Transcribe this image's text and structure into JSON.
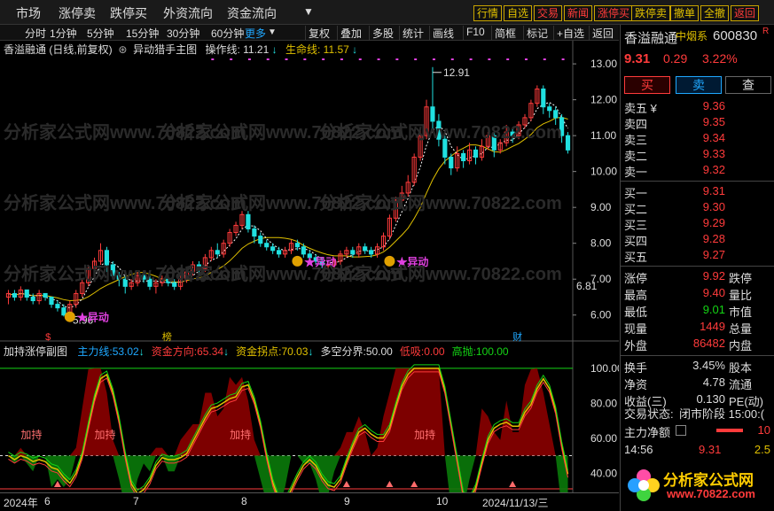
{
  "nav": {
    "items": [
      "市场",
      "涨停卖",
      "跌停买",
      "外资流向",
      "资金流向"
    ],
    "buttons": [
      {
        "label": "行情",
        "red": false
      },
      {
        "label": "自选",
        "red": false
      },
      {
        "label": "交易",
        "red": true
      },
      {
        "label": "新闻",
        "red": true
      },
      {
        "label": "涨停买",
        "red": true
      },
      {
        "label": "跌停卖",
        "red": false
      },
      {
        "label": "撤单",
        "red": false
      },
      {
        "label": "全撤",
        "red": false
      },
      {
        "label": "返回",
        "red": true
      }
    ]
  },
  "toolbar": {
    "periods": [
      "分时",
      "1分钟",
      "5分钟",
      "15分钟",
      "30分钟",
      "60分钟"
    ],
    "more": "更多",
    "tools": [
      "复权",
      "叠加",
      "多股",
      "统计",
      "画线",
      "F10",
      "简框",
      "标记",
      "+自选",
      "返回"
    ]
  },
  "main_chart": {
    "title": "香溢融通 (日线,前复权)",
    "indicator_name": "异动猎手主图",
    "op_line_label": "操作线:",
    "op_line_value": "11.21",
    "life_line_label": "生命线:",
    "life_line_value": "11.57",
    "max_label": "12.91",
    "min_label": "5.96",
    "signal_label": "★异动",
    "y_ticks": [
      "13.00",
      "12.00",
      "11.00",
      "10.00",
      "9.00",
      "8.00",
      "7.00",
      "6.00"
    ],
    "current_price_tag": "6.81",
    "markers": [
      "$",
      "榜",
      "财"
    ]
  },
  "sub_chart": {
    "title": "加持涨停副图",
    "fields": [
      {
        "label": "主力线:",
        "value": "53.02",
        "color": "#1fa8ff"
      },
      {
        "label": "资金方向:",
        "value": "65.34",
        "color": "#ff3b3b"
      },
      {
        "label": "资金拐点:",
        "value": "70.03",
        "color": "#e0c000"
      },
      {
        "label": "多空分界:",
        "value": "50.00",
        "color": "#dddddd"
      },
      {
        "label": "低吸:",
        "value": "0.00",
        "color": "#ff3b3b"
      },
      {
        "label": "高抛:",
        "value": "100.00",
        "color": "#14d414"
      }
    ],
    "y_ticks": [
      "100.00",
      "80.00",
      "60.00",
      "40.00"
    ],
    "hold_label": "加持"
  },
  "x_axis": {
    "labels": [
      "2024年",
      "6",
      "7",
      "8",
      "9",
      "10",
      "2024/11/13/三"
    ]
  },
  "quote": {
    "name": "香溢融通",
    "sector": "中烟系",
    "code": "600830",
    "price": "9.31",
    "change": "0.29",
    "change_pct": "3.22%",
    "buttons": [
      "买",
      "卖",
      "查"
    ],
    "asks": [
      {
        "label": "卖五 ¥",
        "price": "9.36"
      },
      {
        "label": "卖四",
        "price": "9.35"
      },
      {
        "label": "卖三",
        "price": "9.34"
      },
      {
        "label": "卖二",
        "price": "9.33"
      },
      {
        "label": "卖一",
        "price": "9.32"
      }
    ],
    "bids": [
      {
        "label": "买一",
        "price": "9.31"
      },
      {
        "label": "买二",
        "price": "9.30"
      },
      {
        "label": "买三",
        "price": "9.29"
      },
      {
        "label": "买四",
        "price": "9.28"
      },
      {
        "label": "买五",
        "price": "9.27"
      }
    ],
    "stats": [
      {
        "label": "涨停",
        "value": "9.92",
        "color": "up",
        "right": "跌停"
      },
      {
        "label": "最高",
        "value": "9.40",
        "color": "up",
        "right": "量比"
      },
      {
        "label": "最低",
        "value": "9.01",
        "color": "dn",
        "right": "市值"
      },
      {
        "label": "现量",
        "value": "1449",
        "color": "up",
        "right": "总量"
      },
      {
        "label": "外盘",
        "value": "86482",
        "color": "up",
        "right": "内盘"
      }
    ],
    "stats2": [
      {
        "label": "换手",
        "value": "3.45%",
        "right": "股本"
      },
      {
        "label": "净资",
        "value": "4.78",
        "right": "流通"
      },
      {
        "label": "收益(三)",
        "value": "0.130",
        "right": "PE(动)"
      }
    ],
    "trade_status_label": "交易状态:",
    "trade_status_value": "闭市阶段 15:00:(",
    "net_label": "主力净额",
    "net_value": "10",
    "tick_time": "14:56",
    "tick_price": "9.31",
    "tick_vol": "2.5",
    "watermark": "分析家公式网",
    "watermark_url": "www.70822.com"
  },
  "chart_data": {
    "type": "candlestick",
    "ylim": [
      5.5,
      13.2
    ],
    "candles": [
      [
        6.5,
        6.6,
        6.3,
        6.7
      ],
      [
        6.6,
        6.5,
        6.4,
        6.7
      ],
      [
        6.5,
        6.7,
        6.4,
        6.8
      ],
      [
        6.7,
        6.5,
        6.4,
        6.7
      ],
      [
        6.5,
        6.4,
        6.3,
        6.6
      ],
      [
        6.4,
        6.6,
        6.3,
        6.7
      ],
      [
        6.6,
        6.5,
        6.4,
        6.6
      ],
      [
        6.5,
        6.3,
        6.2,
        6.5
      ],
      [
        6.3,
        6.2,
        6.1,
        6.4
      ],
      [
        6.2,
        6.0,
        5.96,
        6.3
      ],
      [
        6.0,
        6.3,
        5.96,
        6.4
      ],
      [
        6.3,
        6.6,
        6.2,
        6.7
      ],
      [
        6.6,
        6.9,
        6.5,
        7.0
      ],
      [
        6.9,
        7.3,
        6.8,
        7.4
      ],
      [
        7.3,
        7.5,
        7.1,
        7.6
      ],
      [
        7.5,
        7.8,
        7.4,
        8.0
      ],
      [
        7.8,
        7.4,
        7.2,
        7.9
      ],
      [
        7.4,
        7.1,
        7.0,
        7.5
      ],
      [
        7.1,
        7.0,
        6.8,
        7.2
      ],
      [
        7.0,
        6.8,
        6.6,
        7.1
      ],
      [
        6.8,
        6.9,
        6.7,
        7.0
      ],
      [
        6.9,
        7.1,
        6.8,
        7.2
      ],
      [
        7.1,
        7.0,
        6.9,
        7.2
      ],
      [
        7.0,
        6.8,
        6.7,
        7.1
      ],
      [
        6.8,
        6.9,
        6.6,
        7.0
      ],
      [
        6.9,
        7.0,
        6.8,
        7.1
      ],
      [
        7.0,
        6.9,
        6.8,
        7.1
      ],
      [
        6.9,
        6.8,
        6.7,
        7.0
      ],
      [
        6.8,
        7.0,
        6.7,
        7.1
      ],
      [
        7.0,
        7.2,
        6.9,
        7.3
      ],
      [
        7.2,
        7.4,
        7.1,
        7.5
      ],
      [
        7.4,
        7.3,
        7.1,
        7.5
      ],
      [
        7.3,
        7.6,
        7.2,
        7.7
      ],
      [
        7.6,
        7.8,
        7.5,
        7.9
      ],
      [
        7.8,
        7.7,
        7.6,
        8.0
      ],
      [
        7.7,
        8.0,
        7.6,
        8.1
      ],
      [
        8.0,
        8.3,
        7.9,
        8.4
      ],
      [
        8.3,
        8.5,
        8.2,
        8.6
      ],
      [
        8.5,
        8.8,
        8.4,
        8.9
      ],
      [
        8.8,
        8.4,
        8.3,
        8.9
      ],
      [
        8.4,
        8.2,
        8.0,
        8.5
      ],
      [
        8.2,
        8.0,
        7.9,
        8.3
      ],
      [
        8.0,
        7.9,
        7.8,
        8.1
      ],
      [
        7.9,
        7.8,
        7.7,
        8.0
      ],
      [
        7.8,
        7.7,
        7.6,
        7.9
      ],
      [
        7.7,
        7.8,
        7.6,
        7.9
      ],
      [
        7.8,
        8.0,
        7.7,
        8.1
      ],
      [
        8.0,
        7.9,
        7.8,
        8.1
      ],
      [
        7.9,
        7.7,
        7.6,
        8.0
      ],
      [
        7.7,
        7.6,
        7.5,
        7.8
      ],
      [
        7.6,
        7.5,
        7.4,
        7.7
      ],
      [
        7.5,
        7.4,
        7.3,
        7.6
      ],
      [
        7.4,
        7.4,
        7.3,
        7.5
      ],
      [
        7.4,
        7.5,
        7.3,
        7.6
      ],
      [
        7.5,
        7.7,
        7.4,
        7.8
      ],
      [
        7.7,
        7.8,
        7.6,
        7.9
      ],
      [
        7.8,
        7.7,
        7.6,
        7.9
      ],
      [
        7.7,
        7.9,
        7.6,
        8.0
      ],
      [
        7.9,
        7.8,
        7.7,
        8.0
      ],
      [
        7.8,
        7.7,
        7.6,
        7.9
      ],
      [
        7.7,
        7.9,
        7.6,
        8.0
      ],
      [
        7.9,
        8.2,
        7.8,
        8.3
      ],
      [
        8.2,
        8.7,
        8.1,
        8.8
      ],
      [
        8.7,
        9.2,
        8.6,
        9.3
      ],
      [
        9.2,
        9.4,
        9.0,
        9.6
      ],
      [
        9.4,
        9.7,
        9.3,
        9.9
      ],
      [
        9.7,
        10.4,
        9.6,
        10.5
      ],
      [
        10.4,
        11.0,
        10.3,
        11.2
      ],
      [
        11.0,
        11.8,
        10.9,
        12.0
      ],
      [
        11.8,
        11.4,
        11.2,
        12.91
      ],
      [
        11.4,
        10.9,
        10.7,
        11.6
      ],
      [
        10.9,
        10.4,
        10.2,
        11.0
      ],
      [
        10.4,
        10.1,
        9.9,
        10.5
      ],
      [
        10.1,
        10.5,
        10.0,
        10.7
      ],
      [
        10.5,
        10.3,
        10.1,
        10.6
      ],
      [
        10.3,
        10.6,
        10.2,
        10.8
      ],
      [
        10.6,
        10.4,
        10.2,
        10.7
      ],
      [
        10.4,
        10.7,
        10.3,
        10.9
      ],
      [
        10.7,
        11.0,
        10.6,
        11.1
      ],
      [
        11.0,
        10.6,
        10.4,
        11.1
      ],
      [
        10.6,
        10.8,
        10.5,
        10.9
      ],
      [
        10.8,
        11.1,
        10.7,
        11.3
      ],
      [
        11.1,
        11.0,
        10.8,
        11.2
      ],
      [
        11.0,
        11.3,
        10.9,
        11.4
      ],
      [
        11.3,
        11.5,
        11.2,
        11.6
      ],
      [
        11.5,
        11.9,
        11.4,
        12.0
      ],
      [
        11.9,
        12.3,
        11.8,
        12.4
      ],
      [
        12.3,
        11.8,
        11.6,
        12.4
      ],
      [
        11.8,
        11.7,
        11.5,
        11.9
      ],
      [
        11.7,
        11.5,
        11.3,
        11.8
      ],
      [
        11.5,
        11.0,
        10.8,
        11.6
      ],
      [
        11.0,
        10.6,
        10.5,
        11.1
      ]
    ]
  },
  "colors": {
    "up": "#ff3b3b",
    "down": "#14d414",
    "cyan": "#20e0e0",
    "life": "#e0c000",
    "magenta": "#e040e0"
  }
}
